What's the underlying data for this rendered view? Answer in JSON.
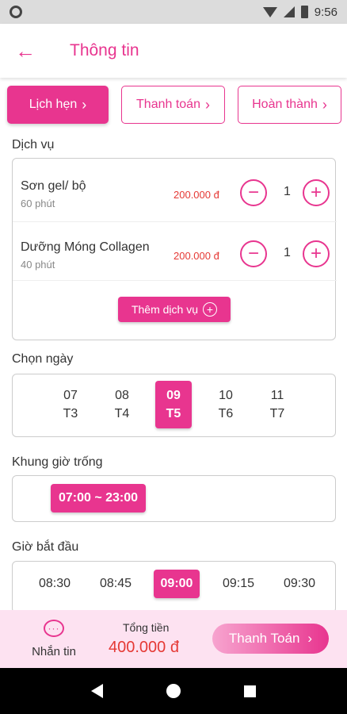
{
  "status_bar": {
    "time": "9:56"
  },
  "header": {
    "title": "Thông tin"
  },
  "steps": [
    {
      "label": "Lịch hẹn",
      "active": true
    },
    {
      "label": "Thanh toán",
      "active": false
    },
    {
      "label": "Hoàn thành",
      "active": false
    }
  ],
  "services": {
    "label": "Dịch vụ",
    "items": [
      {
        "name": "Sơn gel/ bộ",
        "duration": "60 phút",
        "price": "200.000 đ",
        "quantity": "1"
      },
      {
        "name": "Dưỡng Móng Collagen",
        "duration": "40 phút",
        "price": "200.000 đ",
        "quantity": "1"
      }
    ],
    "add_label": "Thêm dịch vụ"
  },
  "date_picker": {
    "label": "Chọn ngày",
    "dates": [
      {
        "day": "07",
        "weekday": "T3",
        "selected": false
      },
      {
        "day": "08",
        "weekday": "T4",
        "selected": false
      },
      {
        "day": "09",
        "weekday": "T5",
        "selected": true
      },
      {
        "day": "10",
        "weekday": "T6",
        "selected": false
      },
      {
        "day": "11",
        "weekday": "T7",
        "selected": false
      }
    ]
  },
  "free_slots": {
    "label": "Khung giờ trống",
    "slot": "07:00 ~ 23:00"
  },
  "start_time": {
    "label": "Giờ bắt đầu",
    "times": [
      {
        "value": "08:30",
        "selected": false
      },
      {
        "value": "08:45",
        "selected": false
      },
      {
        "value": "09:00",
        "selected": true
      },
      {
        "value": "09:15",
        "selected": false
      },
      {
        "value": "09:30",
        "selected": false
      }
    ]
  },
  "bottom_bar": {
    "message_label": "Nhắn tin",
    "total_label": "Tổng tiền",
    "total_value": "400.000 đ",
    "pay_label": "Thanh Toán"
  },
  "colors": {
    "accent": "#e8358f",
    "price": "#e53935",
    "bottom_bg": "#fde2f1"
  }
}
